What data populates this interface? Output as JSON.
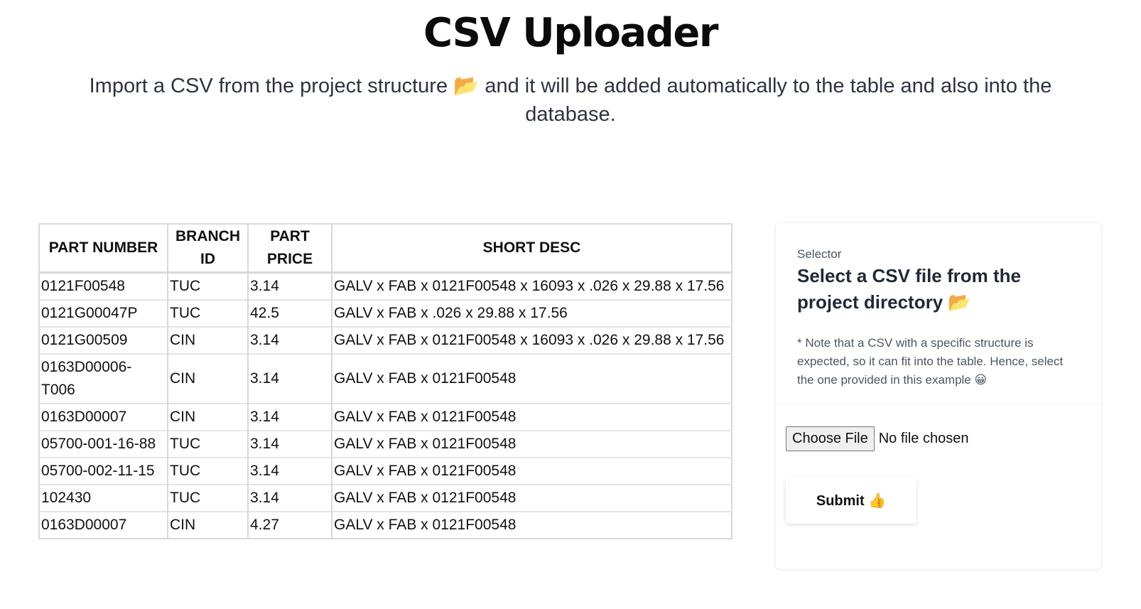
{
  "header": {
    "title": "CSV Uploader",
    "subtitle_before_icon": "Import a CSV from the project structure",
    "subtitle_icon": "📂",
    "subtitle_after_icon": "and it will be added automatically to the table and also into the database."
  },
  "table": {
    "columns": [
      "PART NUMBER",
      "BRANCH ID",
      "PART PRICE",
      "SHORT DESC"
    ],
    "rows": [
      [
        "0121F00548",
        "TUC",
        "3.14",
        "GALV x FAB x 0121F00548 x 16093 x .026 x 29.88 x 17.56"
      ],
      [
        "0121G00047P",
        "TUC",
        "42.5",
        "GALV x FAB x .026 x 29.88 x 17.56"
      ],
      [
        "0121G00509",
        "CIN",
        "3.14",
        "GALV x FAB x 0121F00548 x 16093 x .026 x 29.88 x 17.56"
      ],
      [
        "0163D00006-T006",
        "CIN",
        "3.14",
        "GALV x FAB x 0121F00548"
      ],
      [
        "0163D00007",
        "CIN",
        "3.14",
        "GALV x FAB x 0121F00548"
      ],
      [
        "05700-001-16-88",
        "TUC",
        "3.14",
        "GALV x FAB x 0121F00548"
      ],
      [
        "05700-002-11-15",
        "TUC",
        "3.14",
        "GALV x FAB x 0121F00548"
      ],
      [
        "102430",
        "TUC",
        "3.14",
        "GALV x FAB x 0121F00548"
      ],
      [
        "0163D00007",
        "CIN",
        "4.27",
        "GALV x FAB x 0121F00548"
      ]
    ]
  },
  "selector": {
    "eyebrow": "Selector",
    "heading": "Select a CSV file from the project directory",
    "heading_icon": "📂",
    "note": "* Note that a CSV with a specific structure is expected, so it can fit into the table. Hence, select the one provided in this example",
    "note_icon": "😀",
    "choose_file_label": "Choose File",
    "file_status": "No file chosen",
    "submit_label": "Submit",
    "submit_icon": "👍"
  }
}
